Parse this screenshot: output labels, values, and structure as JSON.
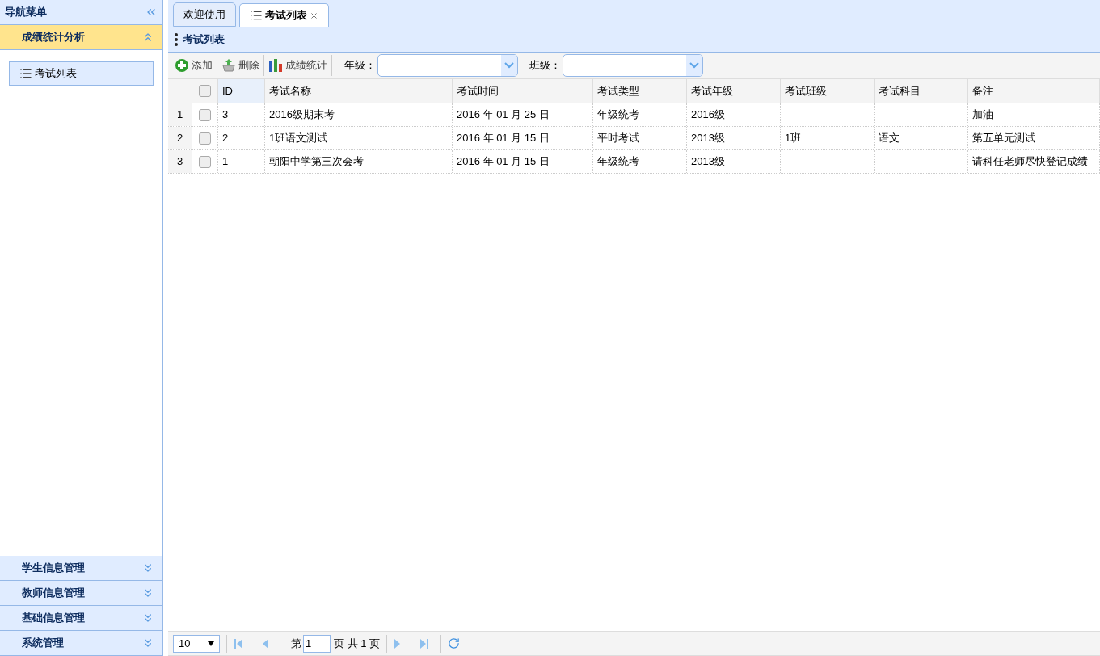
{
  "nav": {
    "title": "导航菜单",
    "sections": [
      {
        "title": "成绩统计分析",
        "expanded": true,
        "children": [
          {
            "label": "考试列表",
            "selected": true
          }
        ]
      },
      {
        "title": "学生信息管理",
        "expanded": false
      },
      {
        "title": "教师信息管理",
        "expanded": false
      },
      {
        "title": "基础信息管理",
        "expanded": false
      },
      {
        "title": "系统管理",
        "expanded": false
      }
    ]
  },
  "tabs": [
    {
      "label": "欢迎使用",
      "selected": false,
      "closable": false,
      "icon": false
    },
    {
      "label": "考试列表",
      "selected": true,
      "closable": true,
      "icon": true
    }
  ],
  "panel": {
    "title": "考试列表"
  },
  "toolbar": [
    {
      "label": "添加",
      "kind": "add"
    },
    {
      "label": "删除",
      "kind": "delete"
    },
    {
      "label": "成绩统计",
      "kind": "chart"
    }
  ],
  "filters": [
    {
      "label": "年级："
    },
    {
      "label": "班级："
    }
  ],
  "table": {
    "columns": [
      "ID",
      "考试名称",
      "考试时间",
      "考试类型",
      "考试年级",
      "考试班级",
      "考试科目",
      "备注"
    ],
    "all_checked": false,
    "rows": [
      {
        "number": "1",
        "checked": false,
        "cells": [
          "3",
          "2016级期末考",
          "2016 年 01 月 25 日",
          "年级统考",
          "2016级",
          "",
          "",
          "加油"
        ]
      },
      {
        "number": "2",
        "checked": false,
        "cells": [
          "2",
          "1班语文测试",
          "2016 年 01 月 15 日",
          "平时考试",
          "2013级",
          "1班",
          "语文",
          "第五单元测试"
        ]
      },
      {
        "number": "3",
        "checked": false,
        "cells": [
          "1",
          "朝阳中学第三次会考",
          "2016 年 01 月 15 日",
          "年级统考",
          "2013级",
          "",
          "",
          "请科任老师尽快登记成绩"
        ]
      }
    ]
  },
  "pager": {
    "page_size": "10",
    "page_prefix": "第",
    "page": "1",
    "page_suffix": "页 共 1 页"
  }
}
